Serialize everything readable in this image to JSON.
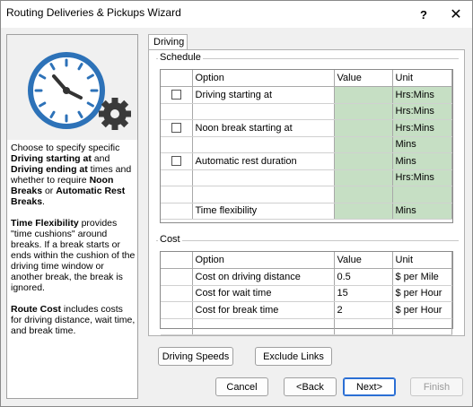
{
  "window": {
    "title": "Routing Deliveries & Pickups Wizard",
    "help_glyph": "?",
    "close_glyph": "✕"
  },
  "left_panel": {
    "icon": "clock-gear-icon",
    "p1": {
      "a": "Choose to specify specific ",
      "b1": "Driving starting at",
      "c": " and ",
      "b2": "Driving ending at",
      "d": " times and whether to require ",
      "b3": "Noon Breaks",
      "e": " or ",
      "b4": "Automatic Rest Breaks",
      "f": "."
    },
    "p2": {
      "b1": "Time Flexibility",
      "a": " provides \"time cushions\" around breaks. If a break starts or ends within the cushion of the driving time window or another break, the break is ignored."
    },
    "p3": {
      "b1": "Route Cost",
      "a": " includes costs for driving distance, wait time, and break time."
    }
  },
  "tab": {
    "label": "Driving"
  },
  "schedule": {
    "label": "Schedule",
    "headers": {
      "option": "Option",
      "value": "Value",
      "unit": "Unit"
    },
    "rows": [
      {
        "checkbox": true,
        "option": "Driving starting at",
        "value": "",
        "unit": "Hrs:Mins",
        "green": true
      },
      {
        "checkbox": false,
        "option": "",
        "value": "",
        "unit": "Hrs:Mins",
        "green": true
      },
      {
        "checkbox": true,
        "option": "Noon break starting at",
        "value": "",
        "unit": "Hrs:Mins",
        "green": true
      },
      {
        "checkbox": false,
        "option": "",
        "value": "",
        "unit": "Mins",
        "green": true
      },
      {
        "checkbox": true,
        "option": "Automatic rest duration",
        "value": "",
        "unit": "Mins",
        "green": true
      },
      {
        "checkbox": false,
        "option": "",
        "value": "",
        "unit": "Hrs:Mins",
        "green": true
      },
      {
        "checkbox": false,
        "option": "",
        "value": "",
        "unit": "",
        "green": true
      },
      {
        "checkbox": false,
        "option": "Time flexibility",
        "value": "",
        "unit": "Mins",
        "green": true
      }
    ]
  },
  "cost": {
    "label": "Cost",
    "headers": {
      "option": "Option",
      "value": "Value",
      "unit": "Unit"
    },
    "rows": [
      {
        "option": "Cost on driving distance",
        "value": "0.5",
        "unit": "$ per Mile"
      },
      {
        "option": "Cost for wait time",
        "value": "15",
        "unit": "$ per Hour"
      },
      {
        "option": "Cost for break time",
        "value": "2",
        "unit": "$ per Hour"
      },
      {
        "option": "",
        "value": "",
        "unit": ""
      }
    ]
  },
  "buttons": {
    "driving_speeds": "Driving Speeds",
    "exclude_links": "Exclude Links",
    "cancel": "Cancel",
    "back": "<Back",
    "next": "Next>",
    "finish": "Finish"
  }
}
